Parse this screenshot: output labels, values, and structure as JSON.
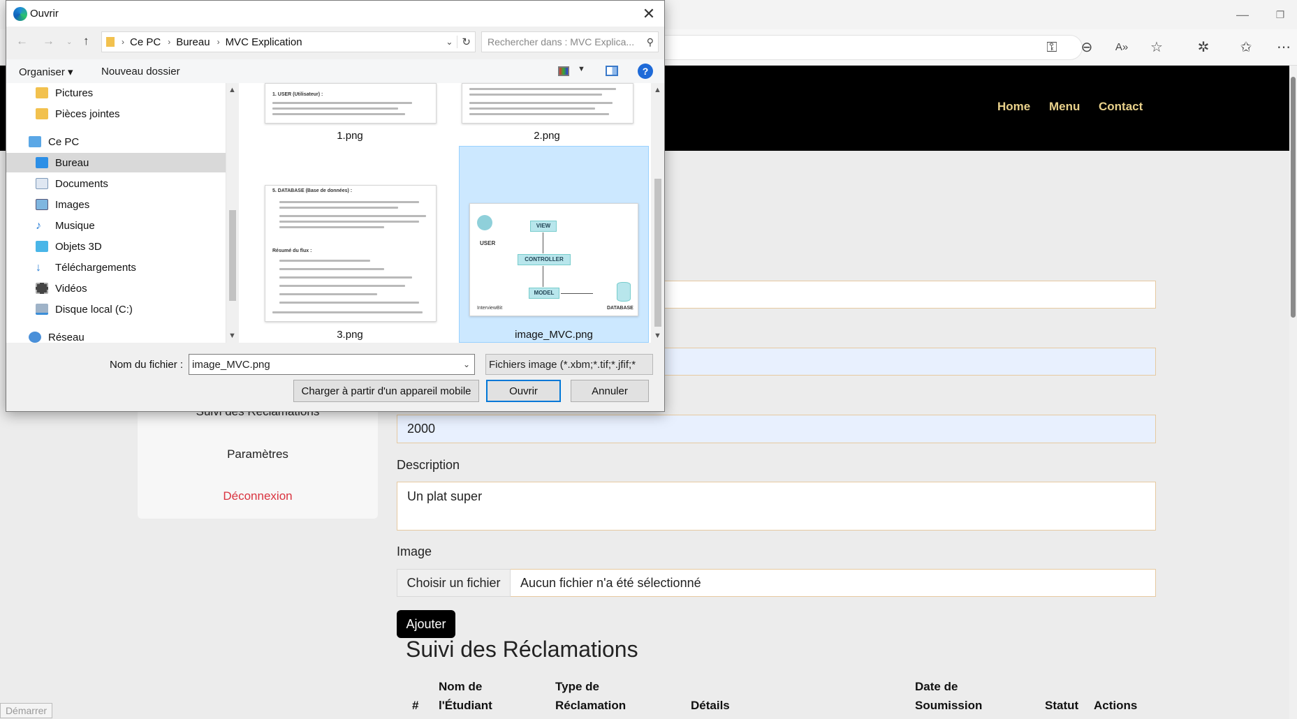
{
  "dialog": {
    "title": "Ouvrir",
    "breadcrumb": [
      "Ce PC",
      "Bureau",
      "MVC Explication"
    ],
    "search_placeholder": "Rechercher dans : MVC Explica...",
    "organize_label": "Organiser ▾",
    "new_folder_label": "Nouveau dossier",
    "nav_items": [
      {
        "label": "Pictures",
        "icon": "folder-icon"
      },
      {
        "label": "Pièces jointes",
        "icon": "folder-icon"
      },
      {
        "label": "Ce PC",
        "icon": "computer-icon"
      },
      {
        "label": "Bureau",
        "icon": "desktop-icon"
      },
      {
        "label": "Documents",
        "icon": "documents-icon"
      },
      {
        "label": "Images",
        "icon": "images-icon"
      },
      {
        "label": "Musique",
        "icon": "music-icon"
      },
      {
        "label": "Objets 3D",
        "icon": "cube-icon"
      },
      {
        "label": "Téléchargements",
        "icon": "download-icon"
      },
      {
        "label": "Vidéos",
        "icon": "video-icon"
      },
      {
        "label": "Disque local (C:)",
        "icon": "drive-icon"
      },
      {
        "label": "Réseau",
        "icon": "network-icon"
      }
    ],
    "files": [
      "1.png",
      "2.png",
      "3.png",
      "image_MVC.png"
    ],
    "thumb_text": {
      "t1_heading": "1. USER (Utilisateur) :",
      "t3_heading": "5. DATABASE (Base de données) :",
      "t3_summary": "Résumé du flux :",
      "mvc": {
        "user": "USER",
        "view": "VIEW",
        "controller": "CONTROLLER",
        "model": "MODEL",
        "database": "DATABASE",
        "brand": "InterviewBit"
      }
    },
    "filename_label": "Nom du fichier :",
    "filename_value": "image_MVC.png",
    "filter_value": "Fichiers image (*.xbm;*.tif;*.jfif;*",
    "mobile_button": "Charger à partir d'un appareil mobile",
    "open_button": "Ouvrir",
    "cancel_button": "Annuler"
  },
  "site": {
    "nav": [
      "Home",
      "Menu",
      "Contact"
    ],
    "sidebar": {
      "partial_item": "Suivi des Réclamations",
      "settings": "Paramètres",
      "logout": "Déconnexion"
    },
    "form": {
      "price_value": "2000",
      "description_label": "Description",
      "description_value": "Un plat super",
      "image_label": "Image",
      "file_button": "Choisir un fichier",
      "file_status": "Aucun fichier n'a été sélectionné",
      "submit": "Ajouter"
    },
    "section_title": "Suivi des Réclamations",
    "table_headers": [
      "#",
      "Nom de l'Étudiant",
      "Type de Réclamation",
      "Détails",
      "Date de Soumission",
      "Statut",
      "Actions"
    ]
  },
  "taskbar": {
    "start": "Démarrer"
  },
  "colors": {
    "nav_link": "#e8d08a",
    "logout": "#d9333f",
    "selection": "#cce8ff",
    "accent": "#0078d7"
  }
}
